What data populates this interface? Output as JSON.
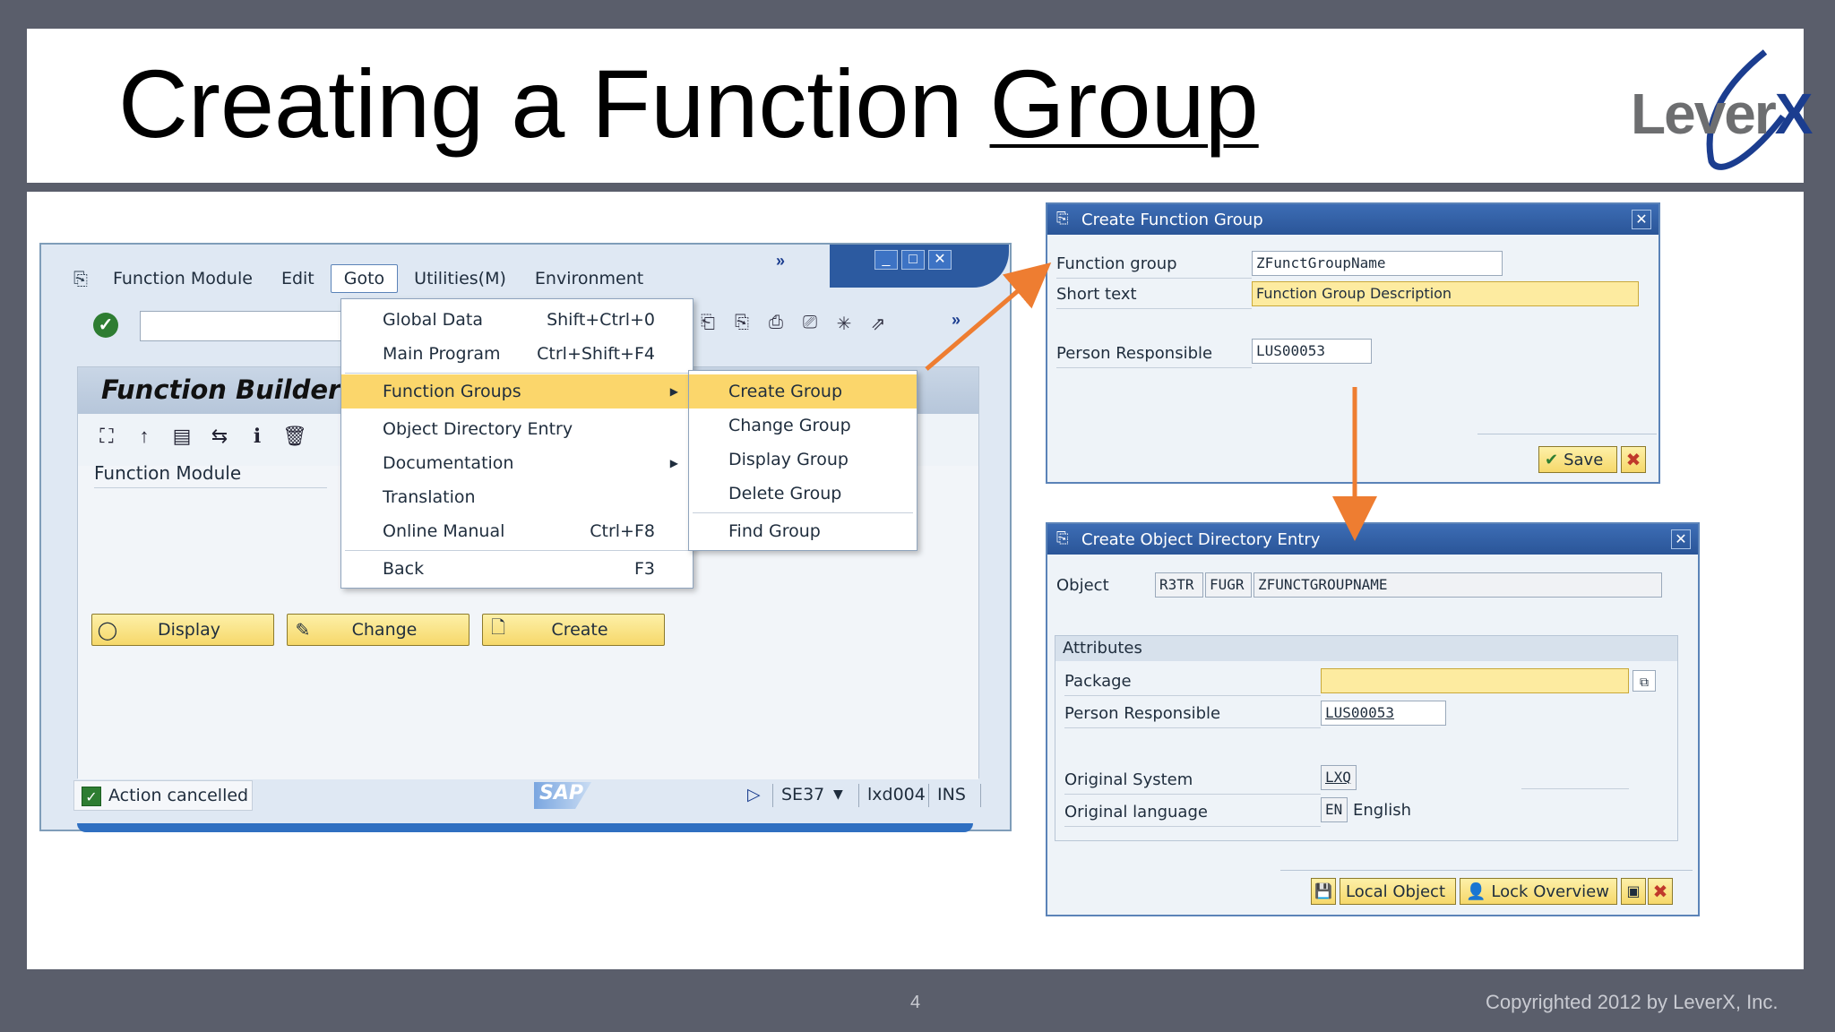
{
  "slide": {
    "title_prefix": "Creating a Function ",
    "title_underlined": "Group",
    "logo_text_a": "Lever",
    "logo_text_b": "X",
    "page_number": "4",
    "copyright": "Copyrighted 2012 by LeverX, Inc."
  },
  "colors": {
    "slide_bg": "#5a5e6b",
    "sap_blue": "#2a5598",
    "button_yellow": "#f6d86a",
    "highlight": "#fbd66b",
    "arrow": "#ee7d31"
  },
  "sap": {
    "menubar": {
      "icon": "exit-menu-icon",
      "items": [
        "Function Module",
        "Edit",
        "Goto",
        "Utilities(M)",
        "Environment"
      ],
      "more": "»"
    },
    "toolbar_more": "»",
    "panel_title": "Function Builder: ",
    "function_module_label": "Function Module",
    "buttons": {
      "display": "Display",
      "change": "Change",
      "create": "Create"
    },
    "status": {
      "message": "Action cancelled",
      "logo": "SAP",
      "transaction": "SE37",
      "server": "lxd004",
      "mode": "INS"
    }
  },
  "goto_menu": [
    {
      "label": "Global Data",
      "shortcut": "Shift+Ctrl+0"
    },
    {
      "label": "Main Program",
      "shortcut": "Ctrl+Shift+F4"
    },
    {
      "label": "Function Groups",
      "shortcut": ""
    },
    {
      "label": "Object Directory Entry",
      "shortcut": ""
    },
    {
      "label": "Documentation",
      "shortcut": ""
    },
    {
      "label": "Translation",
      "shortcut": ""
    },
    {
      "label": "Online Manual",
      "shortcut": "Ctrl+F8"
    },
    {
      "label": "Back",
      "shortcut": "F3"
    }
  ],
  "function_groups_menu": [
    "Create Group",
    "Change Group",
    "Display Group",
    "Delete Group",
    "Find Group"
  ],
  "create_fg_dialog": {
    "title": "Create Function Group",
    "function_group_label": "Function group",
    "function_group_value": "ZFunctGroupName",
    "short_text_label": "Short text",
    "short_text_value": "Function Group Description",
    "person_label": "Person Responsible",
    "person_value": "LUS00053",
    "save_label": "Save"
  },
  "obj_dir_dialog": {
    "title": "Create Object Directory Entry",
    "object_label": "Object",
    "object_pgmid": "R3TR",
    "object_type": "FUGR",
    "object_name": "ZFUNCTGROUPNAME",
    "attributes_label": "Attributes",
    "package_label": "Package",
    "package_value": "",
    "person_label": "Person Responsible",
    "person_value": "LUS00053",
    "orig_system_label": "Original System",
    "orig_system_value": "LXQ",
    "orig_lang_label": "Original language",
    "orig_lang_code": "EN",
    "orig_lang_name": "English",
    "local_object_label": "Local Object",
    "lock_overview_label": "Lock Overview"
  }
}
